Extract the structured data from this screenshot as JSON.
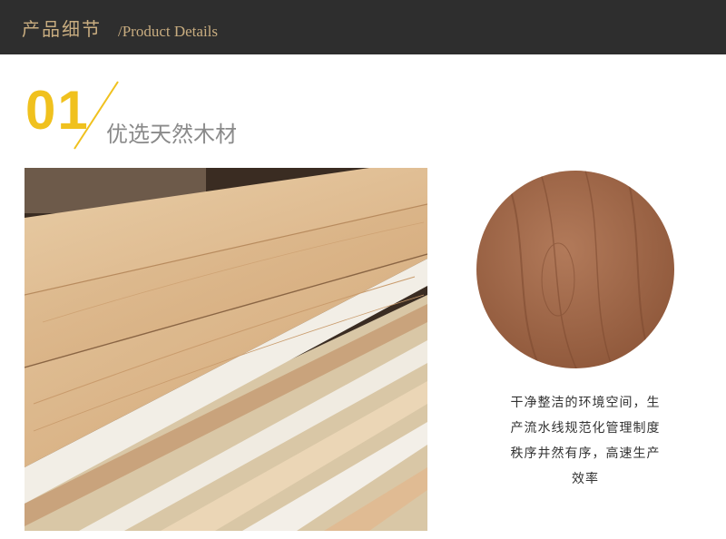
{
  "header": {
    "title_cn": "产品细节",
    "title_en": "/Product Details"
  },
  "section": {
    "number": "01",
    "title": "优选天然木材"
  },
  "description": {
    "lines": [
      "干净整洁的环境空间，生",
      "产流水线规范化管理制度",
      "秩序井然有序，高速生产",
      "效率"
    ]
  },
  "colors": {
    "header_bg": "#2e2e2e",
    "header_text": "#c9ad80",
    "accent": "#f0c11e",
    "title_gray": "#8a8a8a"
  }
}
